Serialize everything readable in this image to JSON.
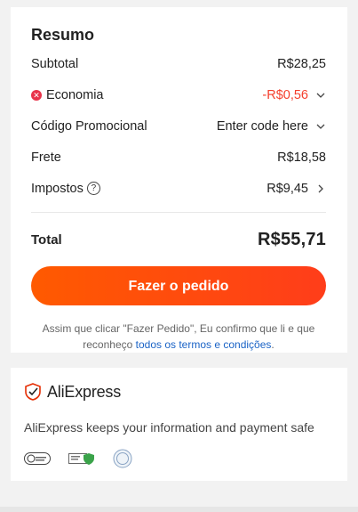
{
  "summary": {
    "title": "Resumo",
    "rows": [
      {
        "label": "Subtotal",
        "value": "R$28,25"
      },
      {
        "label": "Economia",
        "value": "-R$0,56"
      },
      {
        "label": "Código Promocional",
        "value": "Enter code here"
      },
      {
        "label": "Frete",
        "value": "R$18,58"
      },
      {
        "label": "Impostos",
        "value": "R$9,45",
        "help": "?"
      }
    ],
    "total_label": "Total",
    "total_value": "R$55,71",
    "order_button": "Fazer o pedido",
    "consent_text": "Assim que clicar \"Fazer Pedido\", Eu confirmo que li e que reconheço",
    "consent_link": "todos os termos e condições",
    "consent_end": "."
  },
  "security": {
    "brand": "AliExpress",
    "message": "AliExpress keeps your information and payment safe",
    "badges": [
      "privacy-badge-icon",
      "secure-shield-badge-icon",
      "certification-seal-icon"
    ]
  },
  "colors": {
    "accent": "#ff4a0c",
    "saving": "#f43e2c",
    "link": "#1a63c6"
  }
}
